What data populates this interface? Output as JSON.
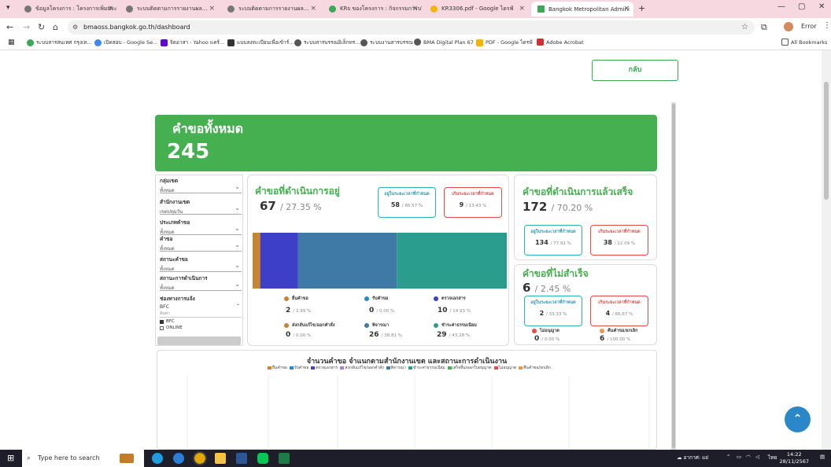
{
  "browser": {
    "tabs": [
      {
        "label": "ข้อมูลโครงการ : โครงการเพิ่มประสิทธิ"
      },
      {
        "label": "ระบบติดตามการรายงานผล..."
      },
      {
        "label": "ระบบติดตามการรายงานผล..."
      },
      {
        "label": "KRs ของโครงการ : กิจกรรมการบริ"
      },
      {
        "label": "KR3306.pdf - Google ไดรฟ์"
      },
      {
        "label": "Bangkok Metropolitan Admini"
      }
    ],
    "new_tab": "+",
    "url": "bmaoss.bangkok.go.th/dashboard",
    "profile": "Error",
    "bookmarks": [
      "ระบบสารสนเทศ กรุงเท...",
      "เปิดสอบ - Google Se...",
      "จิตอาสา - Yahoo แคร์...",
      "แบบลงทะเบียนเพื่อเข้าร์...",
      "ระบบสารบรรณอิเล็กทร...",
      "ระบบงานสารบรรณ",
      "BMA Digital Plan 67",
      "PDF - Google ไดรฟ์",
      "Adobe Acrobat"
    ],
    "all_bookmarks": "All Bookmarks"
  },
  "page": {
    "back_button": "กลับ",
    "total": {
      "title": "คำขอทั้งหมด",
      "value": "245"
    },
    "filters": [
      {
        "label": "กลุ่มเขต",
        "value": "ทั้งหมด"
      },
      {
        "label": "สำนักงานเขต",
        "value": "เขตปทุมวัน"
      },
      {
        "label": "ประเภทคำขอ",
        "value": "ทั้งหมด"
      },
      {
        "label": "คำขอ",
        "value": "ทั้งหมด"
      },
      {
        "label": "สถานะคำขอ",
        "value": "ทั้งหมด"
      },
      {
        "label": "สถานะการดำเนินการ",
        "value": "ทั้งหมด"
      }
    ],
    "channel": {
      "label": "ช่องทางการแจ้ง",
      "value": "BFC",
      "search": "ค้นหา",
      "options": [
        "BFC",
        "ONLINE"
      ]
    },
    "in_progress": {
      "title": "คำขอที่ดำเนินการอยู่",
      "count": "67",
      "pct": "/ 27.35 %",
      "within": {
        "label": "อยู่ในระยะเวลาที่กำหนด",
        "count": "58",
        "pct": "/ 86.57 %"
      },
      "over": {
        "label": "เกินระยะเวลาที่กำหนด",
        "count": "9",
        "pct": "/ 13.43 %"
      },
      "legend": [
        {
          "name": "ยื่นคำขอ",
          "count": "2",
          "pct": "/ 2.99 %",
          "color": "#c8842f"
        },
        {
          "name": "รับคำขอ",
          "count": "0",
          "pct": "/ 0.00 %",
          "color": "#2a88c9"
        },
        {
          "name": "ตรวจเอกสาร",
          "count": "10",
          "pct": "/ 14.93 %",
          "color": "#3d3fc9"
        },
        {
          "name": "ส่งกลับแก้ไข/ออกคำสั่ง",
          "count": "0",
          "pct": "/ 0.00 %",
          "color": "#c8842f"
        },
        {
          "name": "พิจารณา",
          "count": "26",
          "pct": "/ 38.81 %",
          "color": "#3f7aa6"
        },
        {
          "name": "ชำระค่าธรรมเนียม",
          "count": "29",
          "pct": "/ 43.28 %",
          "color": "#2a9d8f"
        }
      ]
    },
    "completed": {
      "title": "คำขอที่ดำเนินการแล้วเสร็จ",
      "count": "172",
      "pct": "/ 70.20 %",
      "within": {
        "label": "อยู่ในระยะเวลาที่กำหนด",
        "count": "134",
        "pct": "/ 77.91 %"
      },
      "over": {
        "label": "เกินระยะเวลาที่กำหนด",
        "count": "38",
        "pct": "/ 22.09 %"
      }
    },
    "failed": {
      "title": "คำขอที่ไม่สำเร็จ",
      "count": "6",
      "pct": "/ 2.45 %",
      "within": {
        "label": "อยู่ในระยะเวลาที่กำหนด",
        "count": "2",
        "pct": "/ 33.33 %"
      },
      "over": {
        "label": "เกินระยะเวลาที่กำหนด",
        "count": "4",
        "pct": "/ 66.67 %"
      },
      "legend": [
        {
          "name": "ไม่อนุญาต",
          "count": "0",
          "pct": "/ 0.00 %",
          "color": "#e34b4b"
        },
        {
          "name": "คืนคำขอ/ยกเลิก",
          "count": "6",
          "pct": "/ 100.00 %",
          "color": "#f0954b"
        }
      ]
    },
    "chart": {
      "title": "จำนวนคำขอ  จำแนกตามสำนักงานเขต และสถานะการดำเนินงาน",
      "legend": [
        {
          "name": "ยื่นคำขอ",
          "color": "#c8842f"
        },
        {
          "name": "รับคำขอ",
          "color": "#2a88c9"
        },
        {
          "name": "ตรวจเอกสาร",
          "color": "#3d3fc9"
        },
        {
          "name": "ส่งกลับแก้ไข/ออกคำสั่ง",
          "color": "#b07fc0"
        },
        {
          "name": "พิจารณา",
          "color": "#3f7aa6"
        },
        {
          "name": "ชำระค่าธรรมเนียม",
          "color": "#2a9d8f"
        },
        {
          "name": "เสร็จสิ้น/ออกใบอนุญาต",
          "color": "#45b04f"
        },
        {
          "name": "ไม่อนุญาต",
          "color": "#e34b4b"
        },
        {
          "name": "คืนคำขอ/ยกเลิก",
          "color": "#f0954b"
        }
      ]
    }
  },
  "taskbar": {
    "search_placeholder": "Type here to search",
    "weather": "อากาศ: แย่",
    "lang": "ไทย",
    "time": "14:22",
    "date": "28/11/2567"
  },
  "chart_data": {
    "type": "bar",
    "categories": [
      "ยื่นคำขอ",
      "รับคำขอ",
      "ตรวจเอกสาร",
      "ส่งกลับแก้ไข/ออกคำสั่ง",
      "พิจารณา",
      "ชำระค่าธรรมเนียม"
    ],
    "values": [
      2,
      0,
      10,
      0,
      26,
      29
    ],
    "colors": [
      "#c8842f",
      "#2a88c9",
      "#3d3fc9",
      "#c8842f",
      "#3f7aa6",
      "#2a9d8f"
    ]
  }
}
